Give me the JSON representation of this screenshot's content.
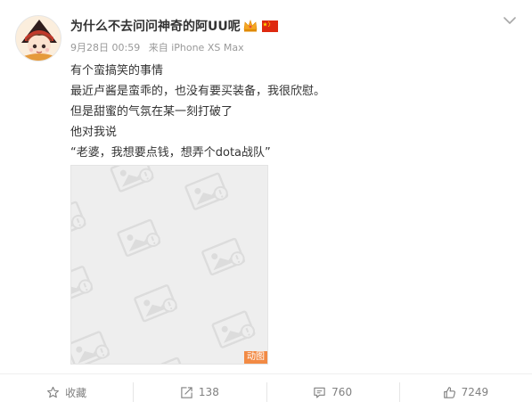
{
  "post": {
    "author": {
      "name": "为什么不去问问神奇的阿UU呢",
      "avatar_icon": "anime-girl-avatar",
      "badges": [
        "vip-crown-icon",
        "china-flag-icon"
      ]
    },
    "meta": {
      "date": "9月28日 00:59",
      "source": "来自 iPhone XS Max"
    },
    "content_lines": [
      "有个蛮搞笑的事情",
      "最近卢酱是蛮乖的，也没有要买装备，我很欣慰。",
      "但是甜蜜的气氛在某一刻打破了",
      "他对我说",
      "“老婆，我想要点钱，想弄个dota战队”"
    ],
    "media": {
      "placeholder_icon": "image-placeholder-icon",
      "gif_label": "动图"
    }
  },
  "toolbar": {
    "favorite": {
      "label": "收藏",
      "icon": "star-icon"
    },
    "repost": {
      "count": "138",
      "icon": "repost-icon"
    },
    "comment": {
      "count": "760",
      "icon": "comment-icon"
    },
    "like": {
      "count": "7249",
      "icon": "thumbs-up-icon"
    }
  },
  "colors": {
    "text": "#333333",
    "meta": "#999999",
    "toolbar_text": "#808080",
    "gif_badge": "#f28a44"
  }
}
